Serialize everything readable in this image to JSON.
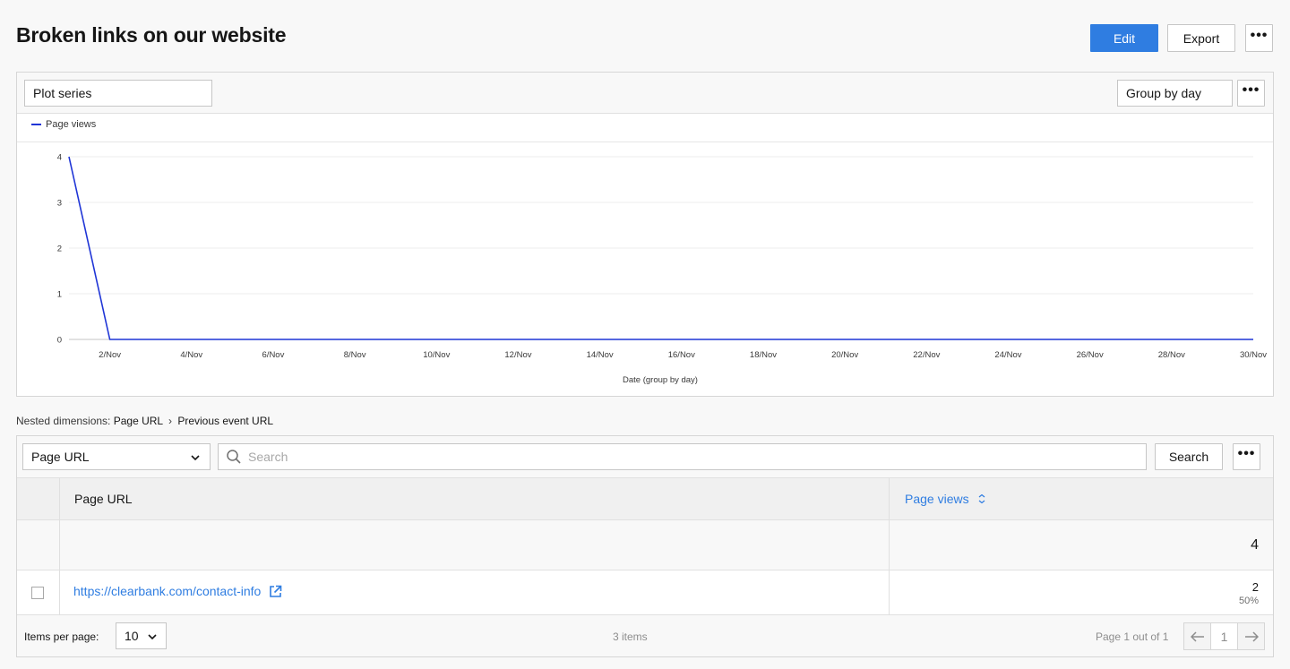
{
  "header": {
    "title": "Broken links on our website",
    "edit_label": "Edit",
    "export_label": "Export",
    "more_label": "•••"
  },
  "chart_panel": {
    "plot_series_label": "Plot series",
    "group_by_label": "Group by day",
    "more_label": "•••"
  },
  "chart_data": {
    "type": "line",
    "series": [
      {
        "name": "Page views",
        "color": "#1f35d6",
        "x": [
          "1/Nov",
          "2/Nov",
          "3/Nov",
          "4/Nov",
          "5/Nov",
          "6/Nov",
          "7/Nov",
          "8/Nov",
          "9/Nov",
          "10/Nov",
          "11/Nov",
          "12/Nov",
          "13/Nov",
          "14/Nov",
          "15/Nov",
          "16/Nov",
          "17/Nov",
          "18/Nov",
          "19/Nov",
          "20/Nov",
          "21/Nov",
          "22/Nov",
          "23/Nov",
          "24/Nov",
          "25/Nov",
          "26/Nov",
          "27/Nov",
          "28/Nov",
          "29/Nov",
          "30/Nov"
        ],
        "values": [
          4,
          0,
          0,
          0,
          0,
          0,
          0,
          0,
          0,
          0,
          0,
          0,
          0,
          0,
          0,
          0,
          0,
          0,
          0,
          0,
          0,
          0,
          0,
          0,
          0,
          0,
          0,
          0,
          0,
          0
        ]
      }
    ],
    "x_tick_labels": [
      "2/Nov",
      "4/Nov",
      "6/Nov",
      "8/Nov",
      "10/Nov",
      "12/Nov",
      "14/Nov",
      "16/Nov",
      "18/Nov",
      "20/Nov",
      "22/Nov",
      "24/Nov",
      "26/Nov",
      "28/Nov",
      "30/Nov"
    ],
    "y_ticks": [
      0,
      1,
      2,
      3,
      4
    ],
    "ylim": [
      0,
      4
    ],
    "xlabel": "Date (group by day)",
    "ylabel": "",
    "legend_position": "top-left",
    "grid": true
  },
  "nested_dimensions": {
    "prefix": "Nested dimensions:",
    "first": "Page URL",
    "separator": "›",
    "second": "Previous event URL"
  },
  "table": {
    "dimension_select": "Page URL",
    "search_placeholder": "Search",
    "search_button": "Search",
    "more_label": "•••",
    "columns": {
      "url": "Page URL",
      "views": "Page views"
    },
    "total_views": "4",
    "rows": [
      {
        "url": "https://clearbank.com/contact-info",
        "views": "2",
        "percent": "50%"
      }
    ],
    "footer": {
      "items_per_page_label": "Items per page:",
      "items_per_page_value": "10",
      "items_count": "3 items",
      "page_info": "Page 1 out of 1",
      "current_page": "1"
    }
  }
}
